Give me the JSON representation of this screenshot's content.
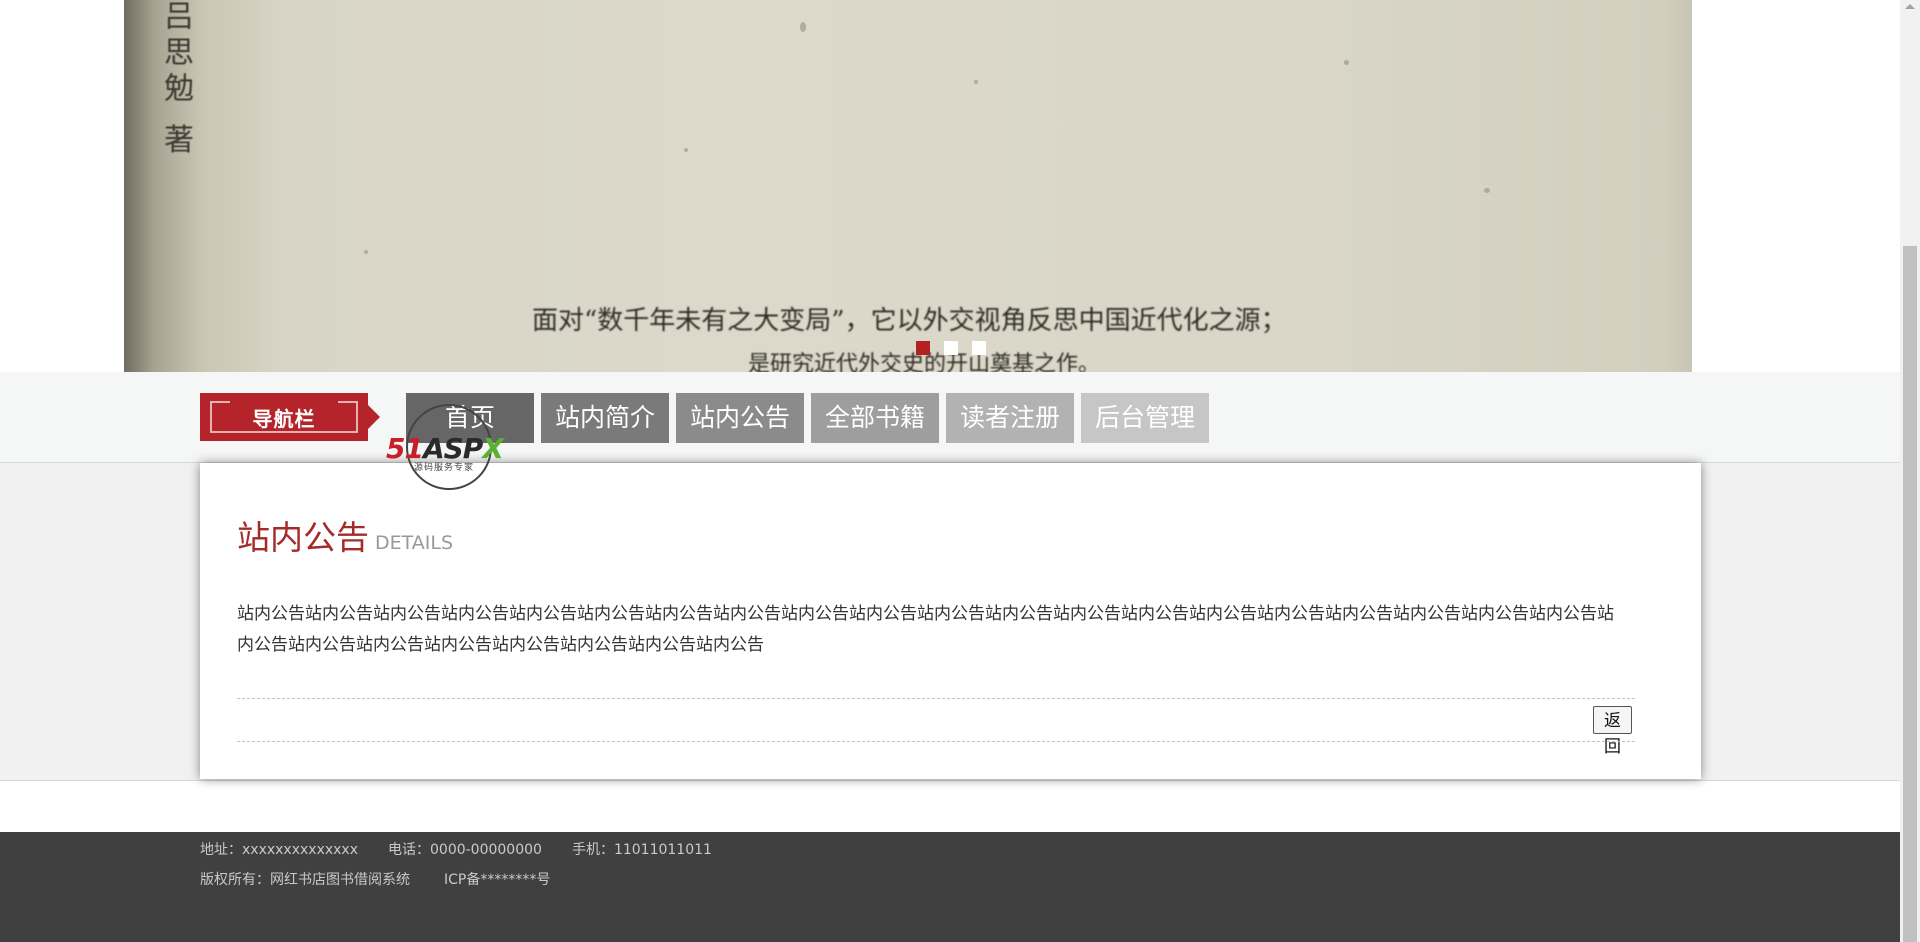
{
  "banner": {
    "vertical_text": "吕思勉 著",
    "caption_line1": "面对“数千年未有之大变局”，它以外交视角反思中国近代化之源；",
    "caption_line2": "是研究近代外交史的开山奠基之作。",
    "slides": 3,
    "active_slide": 1
  },
  "nav": {
    "badge": "导航栏",
    "items": [
      {
        "label": "首页"
      },
      {
        "label": "站内简介"
      },
      {
        "label": "站内公告"
      },
      {
        "label": "全部书籍"
      },
      {
        "label": "读者注册"
      },
      {
        "label": "后台管理"
      }
    ]
  },
  "watermark": {
    "brand_n": "51",
    "brand_a": "ASP",
    "brand_x": "X",
    "tagline": "源码服务专家"
  },
  "article": {
    "title": "站内公告",
    "subtitle": "DETAILS",
    "body": "站内公告站内公告站内公告站内公告站内公告站内公告站内公告站内公告站内公告站内公告站内公告站内公告站内公告站内公告站内公告站内公告站内公告站内公告站内公告站内公告站内公告站内公告站内公告站内公告站内公告站内公告站内公告站内公告",
    "back_label": "返回"
  },
  "footer": {
    "address": "地址：xxxxxxxxxxxxxx",
    "phone": "电话：0000-00000000",
    "mobile": "手机：11011011011",
    "copyright": "版权所有：网红书店图书借阅系统",
    "icp": "ICP备********号"
  },
  "colors": {
    "accent": "#b5232b",
    "title_red": "#a52a2a",
    "footer_bg": "#404040"
  }
}
